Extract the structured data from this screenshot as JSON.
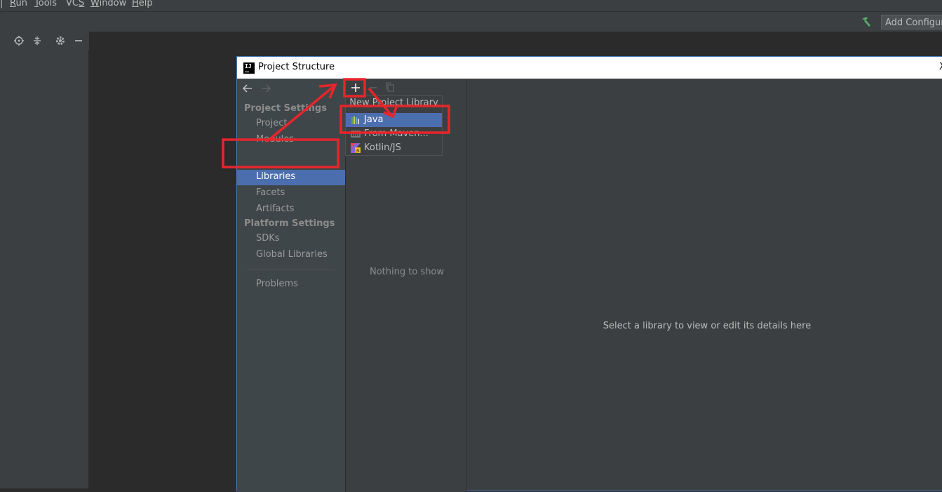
{
  "menu": {
    "items": [
      {
        "label": "Run",
        "mnemonic": "R"
      },
      {
        "label": "Tools",
        "mnemonic": "T"
      },
      {
        "label": "VCS",
        "mnemonic": "S"
      },
      {
        "label": "Window",
        "mnemonic": "W"
      },
      {
        "label": "Help",
        "mnemonic": "H"
      }
    ]
  },
  "toolbar": {
    "add_config_label": "Add Configura"
  },
  "left_panel": {
    "header_icons": [
      "crosshair-icon",
      "collapse-icon",
      "gear-icon",
      "minimize-icon"
    ]
  },
  "dialog": {
    "title": "Project Structure",
    "close_glyph": "X",
    "nav": {
      "sections": [
        {
          "label": "Project Settings",
          "items": [
            "Project",
            "Modules",
            "Libraries",
            "Facets",
            "Artifacts"
          ]
        },
        {
          "label": "Platform Settings",
          "items": [
            "SDKs",
            "Global Libraries"
          ]
        }
      ],
      "problems": "Problems",
      "selected": "Libraries"
    },
    "middle_empty": "Nothing to show",
    "right_empty": "Select a library to view or edit its details here",
    "popup": {
      "title": "New Project Library",
      "items": [
        {
          "label": "Java",
          "icon": "java-library-icon",
          "selected": true
        },
        {
          "label": "From Maven...",
          "icon": "maven-icon",
          "selected": false
        },
        {
          "label": "Kotlin/JS",
          "icon": "kotlin-js-icon",
          "selected": false
        }
      ]
    }
  },
  "colors": {
    "background": "#2b2b2b",
    "panel": "#3c3f41",
    "selection": "#4b6eaf",
    "annotation": "#e8252a",
    "hammer": "#59a869"
  }
}
